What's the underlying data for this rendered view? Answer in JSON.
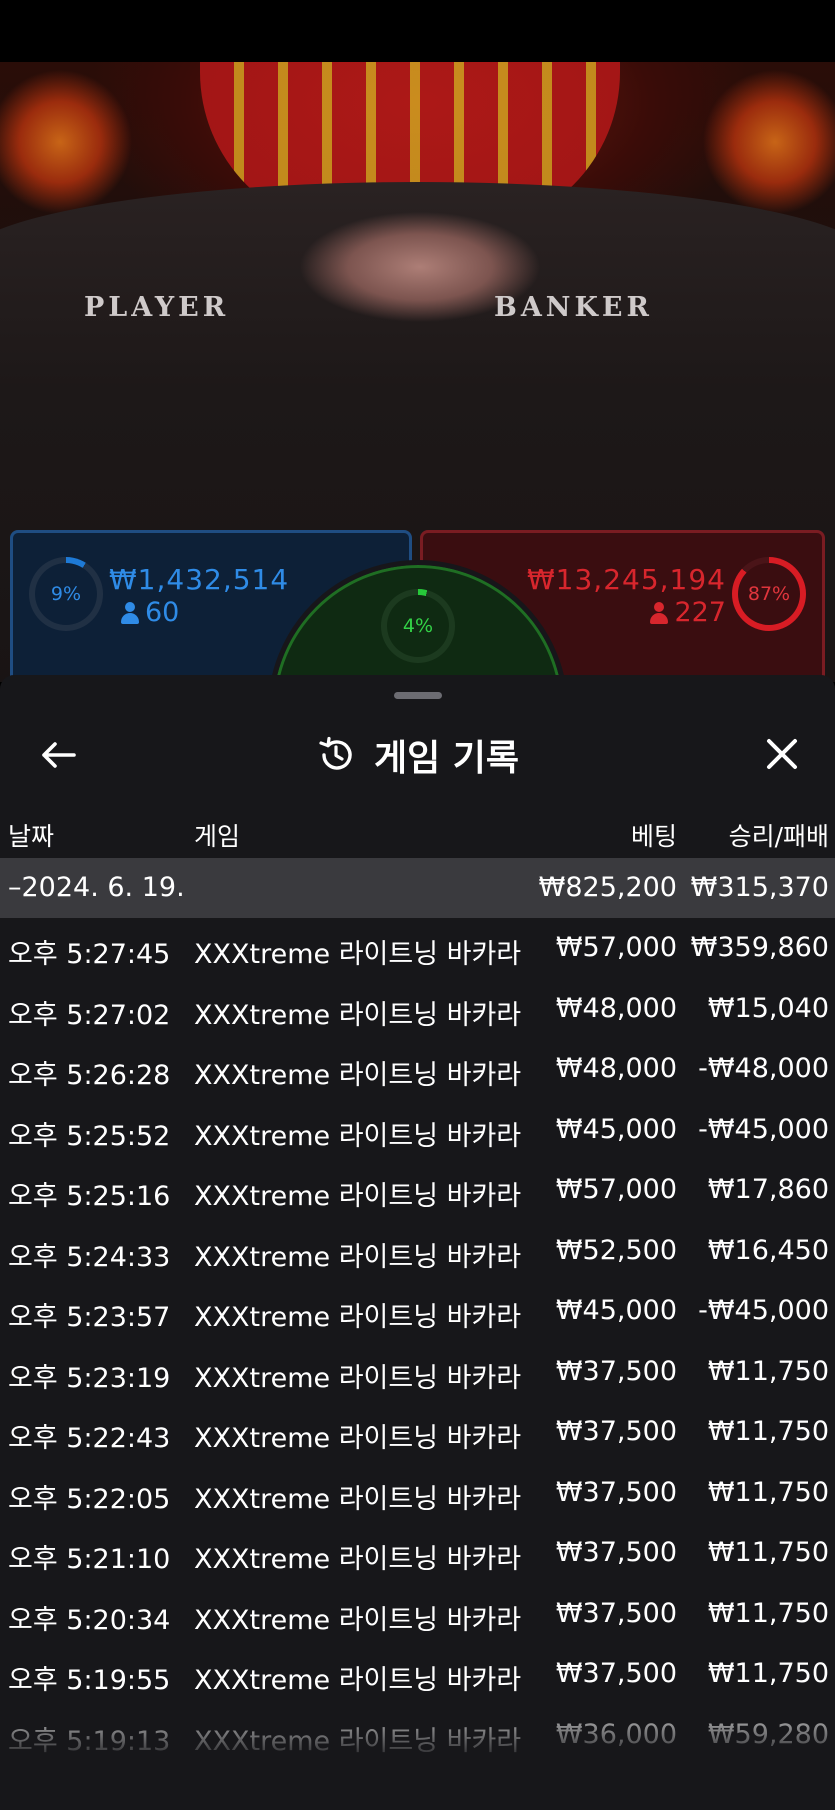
{
  "video": {
    "table_labels": {
      "player": "PLAYER",
      "banker": "BANKER"
    }
  },
  "bets": {
    "player": {
      "percent": "9%",
      "percent_value": 9,
      "amount": "₩1,432,514",
      "players": "60",
      "color": "#1e7ad6"
    },
    "tie": {
      "percent": "4%",
      "percent_value": 4,
      "color": "#27c93a"
    },
    "banker": {
      "percent": "87%",
      "percent_value": 87,
      "amount": "₩13,245,194",
      "players": "227",
      "color": "#d81c24"
    }
  },
  "sheet": {
    "title": "게임 기록",
    "icons": {
      "back": "arrow-left-icon",
      "history": "history-icon",
      "close": "close-icon"
    },
    "columns": {
      "date": "날짜",
      "game": "게임",
      "bet": "베팅",
      "win_loss": "승리/패배"
    },
    "date_group": {
      "date": "–2024. 6. 19.",
      "total_bet": "₩825,200",
      "total_win": "₩315,370"
    },
    "rows": [
      {
        "time": "오후 5:27:45",
        "game": "XXXtreme 라이트닝 바카라",
        "bet": "₩57,000",
        "result": "₩359,860"
      },
      {
        "time": "오후 5:27:02",
        "game": "XXXtreme 라이트닝 바카라",
        "bet": "₩48,000",
        "result": "₩15,040"
      },
      {
        "time": "오후 5:26:28",
        "game": "XXXtreme 라이트닝 바카라",
        "bet": "₩48,000",
        "result": "-₩48,000"
      },
      {
        "time": "오후 5:25:52",
        "game": "XXXtreme 라이트닝 바카라",
        "bet": "₩45,000",
        "result": "-₩45,000"
      },
      {
        "time": "오후 5:25:16",
        "game": "XXXtreme 라이트닝 바카라",
        "bet": "₩57,000",
        "result": "₩17,860"
      },
      {
        "time": "오후 5:24:33",
        "game": "XXXtreme 라이트닝 바카라",
        "bet": "₩52,500",
        "result": "₩16,450"
      },
      {
        "time": "오후 5:23:57",
        "game": "XXXtreme 라이트닝 바카라",
        "bet": "₩45,000",
        "result": "-₩45,000"
      },
      {
        "time": "오후 5:23:19",
        "game": "XXXtreme 라이트닝 바카라",
        "bet": "₩37,500",
        "result": "₩11,750"
      },
      {
        "time": "오후 5:22:43",
        "game": "XXXtreme 라이트닝 바카라",
        "bet": "₩37,500",
        "result": "₩11,750"
      },
      {
        "time": "오후 5:22:05",
        "game": "XXXtreme 라이트닝 바카라",
        "bet": "₩37,500",
        "result": "₩11,750"
      },
      {
        "time": "오후 5:21:10",
        "game": "XXXtreme 라이트닝 바카라",
        "bet": "₩37,500",
        "result": "₩11,750"
      },
      {
        "time": "오후 5:20:34",
        "game": "XXXtreme 라이트닝 바카라",
        "bet": "₩37,500",
        "result": "₩11,750"
      },
      {
        "time": "오후 5:19:55",
        "game": "XXXtreme 라이트닝 바카라",
        "bet": "₩37,500",
        "result": "₩11,750"
      },
      {
        "time": "오후 5:19:13",
        "game": "XXXtreme 라이트닝 바카라",
        "bet": "₩36,000",
        "result": "₩59,280"
      }
    ]
  }
}
